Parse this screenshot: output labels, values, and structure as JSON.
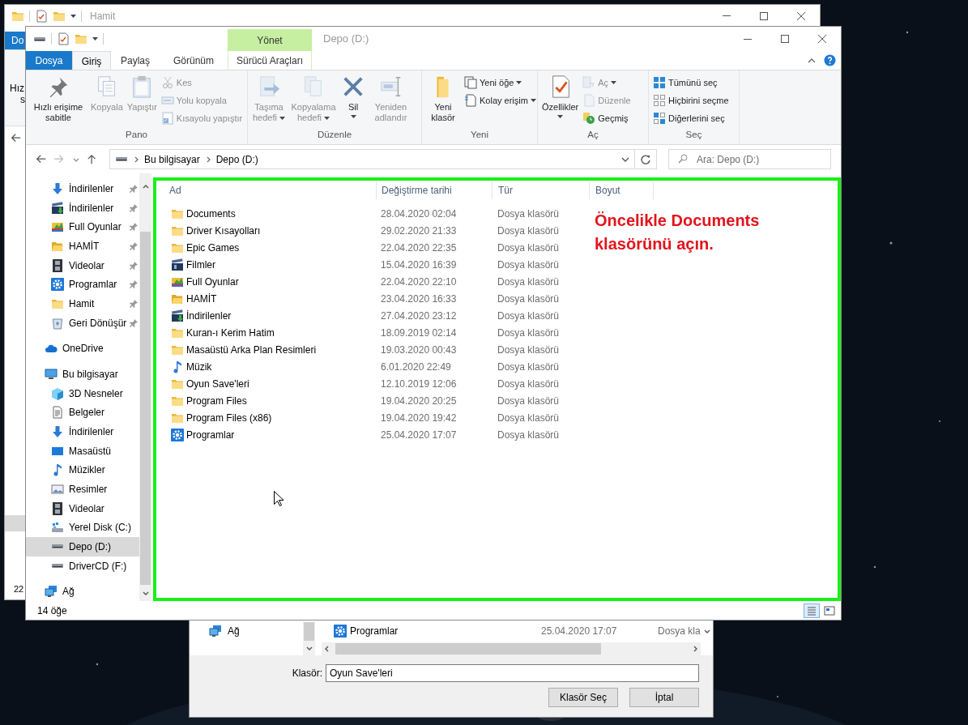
{
  "background_window": {
    "title": "Hamit",
    "tab": "Do",
    "ribbon_texts": [
      "Hız",
      "s"
    ],
    "status": "22"
  },
  "window": {
    "title": "Depo (D:)",
    "context_group": "Yönet"
  },
  "tabs": [
    {
      "label": "Dosya",
      "kind": "file",
      "selected": false
    },
    {
      "label": "Giriş",
      "kind": "tab",
      "selected": true
    },
    {
      "label": "Paylaş",
      "kind": "tab",
      "selected": false
    },
    {
      "label": "Görünüm",
      "kind": "tab",
      "selected": false
    },
    {
      "label": "Sürücü Araçları",
      "kind": "contextual",
      "selected": false
    }
  ],
  "ribbon": [
    {
      "label": "Pano",
      "items": [
        {
          "label": "Hızlı erişime sabitle",
          "kind": "large",
          "disabled": false,
          "dropdown": false
        },
        {
          "label": "Kopyala",
          "kind": "large",
          "disabled": true,
          "dropdown": false
        },
        {
          "label": "Yapıştır",
          "kind": "large",
          "disabled": true,
          "dropdown": false
        },
        {
          "label": "Kes",
          "kind": "small",
          "disabled": true,
          "dropdown": false
        },
        {
          "label": "Yolu kopyala",
          "kind": "small",
          "disabled": true,
          "dropdown": false
        },
        {
          "label": "Kısayolu yapıştır",
          "kind": "small",
          "disabled": true,
          "dropdown": false
        }
      ]
    },
    {
      "label": "Düzenle",
      "items": [
        {
          "label": "Taşıma hedefi",
          "kind": "large",
          "disabled": true,
          "dropdown": true
        },
        {
          "label": "Kopyalama hedefi",
          "kind": "large",
          "disabled": true,
          "dropdown": true
        },
        {
          "label": "Sil",
          "kind": "large",
          "disabled": false,
          "dropdown": true
        },
        {
          "label": "Yeniden adlandır",
          "kind": "large",
          "disabled": true,
          "dropdown": false
        }
      ]
    },
    {
      "label": "Yeni",
      "items": [
        {
          "label": "Yeni klasör",
          "kind": "large",
          "disabled": false,
          "dropdown": false
        },
        {
          "label": "Yeni öğe",
          "kind": "small",
          "disabled": false,
          "dropdown": true
        },
        {
          "label": "Kolay erişim",
          "kind": "small",
          "disabled": false,
          "dropdown": true
        }
      ]
    },
    {
      "label": "Aç",
      "items": [
        {
          "label": "Özellikler",
          "kind": "large",
          "disabled": false,
          "dropdown": true
        },
        {
          "label": "Aç",
          "kind": "small",
          "disabled": true,
          "dropdown": true
        },
        {
          "label": "Düzenle",
          "kind": "small",
          "disabled": true,
          "dropdown": false
        },
        {
          "label": "Geçmiş",
          "kind": "small",
          "disabled": false,
          "dropdown": false
        }
      ]
    },
    {
      "label": "Seç",
      "items": [
        {
          "label": "Tümünü seç",
          "kind": "small",
          "disabled": false,
          "dropdown": false
        },
        {
          "label": "Hiçbirini seçme",
          "kind": "small",
          "disabled": false,
          "dropdown": false
        },
        {
          "label": "Diğerlerini seç",
          "kind": "small",
          "disabled": false,
          "dropdown": false
        }
      ]
    }
  ],
  "address": {
    "path": [
      "Bu bilgisayar",
      "Depo (D:)"
    ],
    "search_placeholder": "Ara: Depo (D:)"
  },
  "navigation": {
    "quick_access": [
      {
        "label": "İndirilenler",
        "kind": "download",
        "pinned": true
      },
      {
        "label": "İndirilenler",
        "kind": "video-download",
        "pinned": true
      },
      {
        "label": "Full Oyunlar",
        "kind": "games",
        "pinned": true
      },
      {
        "label": "HAMİT",
        "kind": "open-folder",
        "pinned": true
      },
      {
        "label": "Videolar",
        "kind": "film",
        "pinned": true
      },
      {
        "label": "Programlar",
        "kind": "gear",
        "pinned": true
      },
      {
        "label": "Hamit",
        "kind": "folder",
        "pinned": true
      },
      {
        "label": "Geri Dönüşür",
        "kind": "recycle",
        "pinned": true
      }
    ],
    "locations": [
      {
        "label": "OneDrive",
        "kind": "cloud",
        "selected": false
      },
      {
        "label": "Bu bilgisayar",
        "kind": "computer",
        "selected": false,
        "children": [
          {
            "label": "3D Nesneler",
            "kind": "cube",
            "selected": false
          },
          {
            "label": "Belgeler",
            "kind": "document",
            "selected": false
          },
          {
            "label": "İndirilenler",
            "kind": "download",
            "selected": false
          },
          {
            "label": "Masaüstü",
            "kind": "desktop",
            "selected": false
          },
          {
            "label": "Müzikler",
            "kind": "music",
            "selected": false
          },
          {
            "label": "Resimler",
            "kind": "picture",
            "selected": false
          },
          {
            "label": "Videolar",
            "kind": "film",
            "selected": false
          },
          {
            "label": "Yerel Disk (C:)",
            "kind": "system-drive",
            "selected": false
          },
          {
            "label": "Depo (D:)",
            "kind": "drive",
            "selected": true
          },
          {
            "label": "DriverCD (F:)",
            "kind": "drive",
            "selected": false
          }
        ]
      },
      {
        "label": "Ağ",
        "kind": "network",
        "selected": false
      }
    ]
  },
  "columns": [
    "Ad",
    "Değiştirme tarihi",
    "Tür",
    "Boyut"
  ],
  "files": [
    {
      "name": "Documents",
      "modified": "28.04.2020 02:04",
      "type": "Dosya klasörü",
      "kind": "folder"
    },
    {
      "name": "Driver Kısayolları",
      "modified": "29.02.2020 21:33",
      "type": "Dosya klasörü",
      "kind": "folder"
    },
    {
      "name": "Epic Games",
      "modified": "22.04.2020 22:35",
      "type": "Dosya klasörü",
      "kind": "folder"
    },
    {
      "name": "Filmler",
      "modified": "15.04.2020 16:39",
      "type": "Dosya klasörü",
      "kind": "video"
    },
    {
      "name": "Full Oyunlar",
      "modified": "22.04.2020 22:10",
      "type": "Dosya klasörü",
      "kind": "games"
    },
    {
      "name": "HAMİT",
      "modified": "23.04.2020 16:33",
      "type": "Dosya klasörü",
      "kind": "open-folder"
    },
    {
      "name": "İndirilenler",
      "modified": "27.04.2020 23:12",
      "type": "Dosya klasörü",
      "kind": "video-download"
    },
    {
      "name": "Kuran-ı Kerim Hatim",
      "modified": "18.09.2019 02:14",
      "type": "Dosya klasörü",
      "kind": "folder"
    },
    {
      "name": "Masaüstü Arka Plan Resimleri",
      "modified": "19.03.2020 00:43",
      "type": "Dosya klasörü",
      "kind": "folder"
    },
    {
      "name": "Müzik",
      "modified": "6.01.2020 22:49",
      "type": "Dosya klasörü",
      "kind": "music"
    },
    {
      "name": "Oyun Save'leri",
      "modified": "12.10.2019 12:06",
      "type": "Dosya klasörü",
      "kind": "folder"
    },
    {
      "name": "Program Files",
      "modified": "19.04.2020 20:25",
      "type": "Dosya klasörü",
      "kind": "folder"
    },
    {
      "name": "Program Files (x86)",
      "modified": "19.04.2020 19:42",
      "type": "Dosya klasörü",
      "kind": "folder"
    },
    {
      "name": "Programlar",
      "modified": "25.04.2020 17:07",
      "type": "Dosya klasörü",
      "kind": "gear"
    }
  ],
  "annotation": "Öncelikle Documents klasörünü açın.",
  "status_bar": "14 öğe",
  "views": [
    {
      "kind": "details",
      "selected": true
    },
    {
      "kind": "tiles",
      "selected": false
    }
  ],
  "dialog": {
    "nav_item": {
      "label": "Ağ",
      "kind": "network"
    },
    "row": {
      "name": "Programlar",
      "modified": "25.04.2020 17:07",
      "type": "Dosya kla",
      "kind": "gear"
    },
    "folder_label": "Klasör:",
    "folder_value": "Oyun Save'leri",
    "buttons": [
      "Klasör Seç",
      "İptal"
    ]
  }
}
